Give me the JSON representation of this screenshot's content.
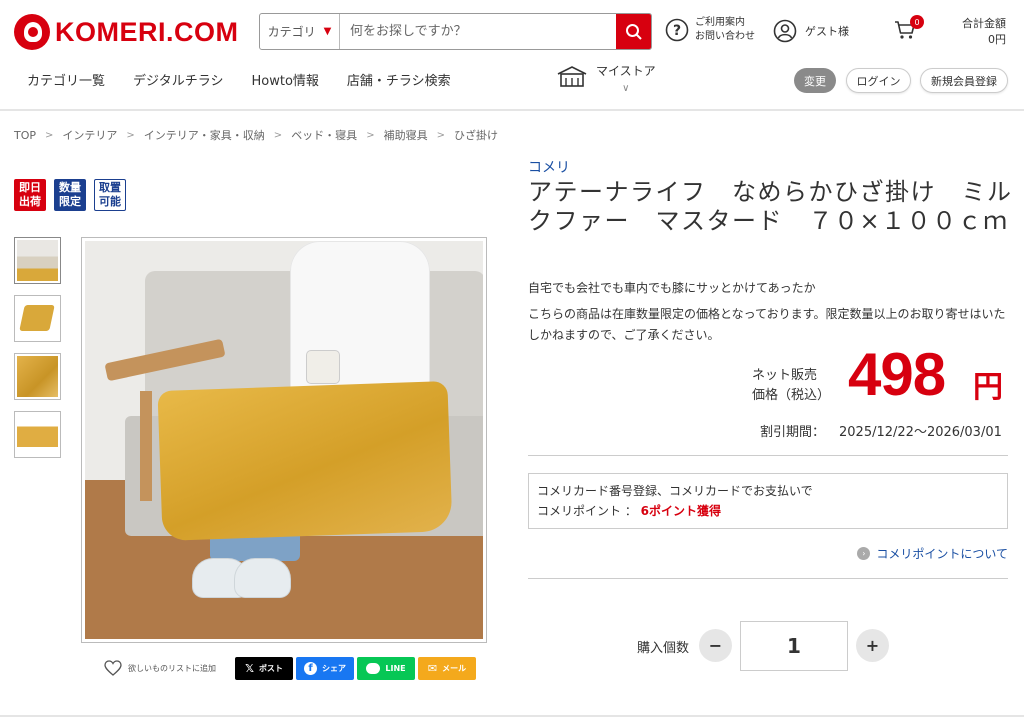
{
  "header": {
    "logo_text": "KOMERI.COM",
    "search": {
      "category_label": "カテゴリ",
      "placeholder": "何をお探しですか？"
    },
    "help": {
      "line1": "ご利用案内",
      "line2": "お問い合わせ"
    },
    "guest_label": "ゲスト様",
    "cart_count": "0",
    "total_label": "合計金額",
    "total_value": "0円"
  },
  "nav": {
    "items": [
      "カテゴリ一覧",
      "デジタルチラシ",
      "Howto情報",
      "店舗・チラシ検索"
    ],
    "mystore_label": "マイストア",
    "change_label": "変更",
    "login_label": "ログイン",
    "register_label": "新規会員登録"
  },
  "breadcrumb": [
    "TOP",
    "インテリア",
    "インテリア・家具・収納",
    "ベッド・寝具",
    "補助寝具",
    "ひざ掛け"
  ],
  "badges": [
    {
      "line1": "即日",
      "line2": "出荷",
      "style": "red"
    },
    {
      "line1": "数量",
      "line2": "限定",
      "style": "navy"
    },
    {
      "line1": "取置",
      "line2": "可能",
      "style": "white"
    }
  ],
  "product": {
    "brand": "コメリ",
    "title": "アテーナライフ　なめらかひざ掛け　ミルクファー　マスタード　７０×１００ｃｍ",
    "desc1": "自宅でも会社でも車内でも膝にサッとかけてあったか",
    "desc2": "こちらの商品は在庫数量限定の価格となっております。限定数量以上のお取り寄せはいたしかねますので、ご了承ください。",
    "price_label_1": "ネット販売",
    "price_label_2": "価格（税込）",
    "price": "498",
    "price_unit": "円",
    "discount_label": "割引期間：",
    "discount_period": "2025/12/22～2026/03/01"
  },
  "points": {
    "line1": "コメリカード番号登録、コメリカードでお支払いで",
    "line2_label": "コメリポイント ： ",
    "line2_value": "6ポイント獲得",
    "link_label": "コメリポイントについて"
  },
  "purchase": {
    "qty_label": "購入個数",
    "qty_value": "1",
    "minus": "−",
    "plus": "+"
  },
  "share": {
    "wishlist_label": "欲しいものリストに追加",
    "x_label": "ポスト",
    "facebook_label": "シェア",
    "line_label": "LINE",
    "mail_label": "メール"
  },
  "colors": {
    "brand_red": "#d7000f",
    "link_blue": "#1a4fa3",
    "badge_navy": "#1b3f8f"
  }
}
